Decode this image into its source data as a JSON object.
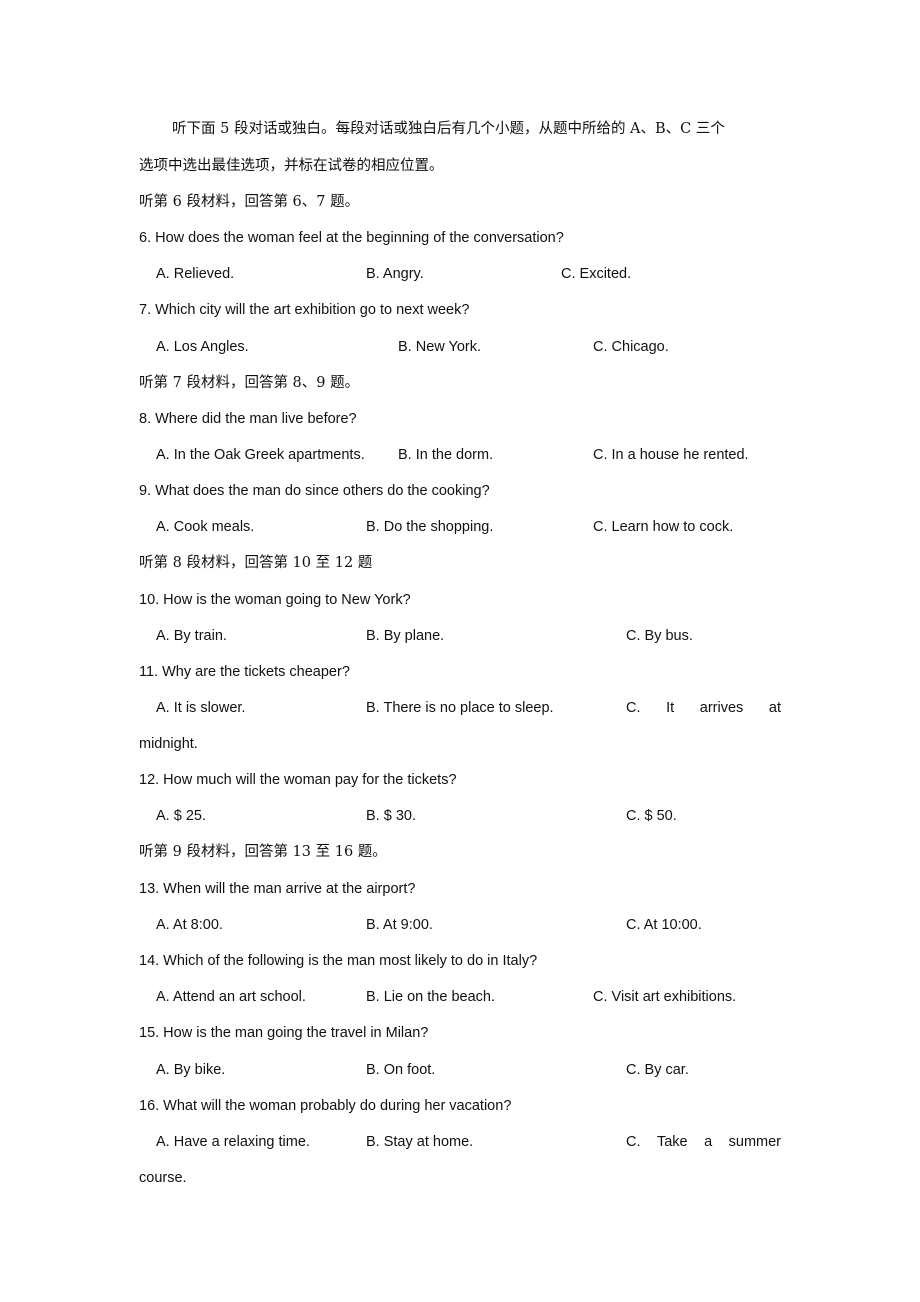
{
  "intro": {
    "line1": "听下面 5 段对话或独白。每段对话或独白后有几个小题，从题中所给的 A、B、C 三个",
    "line2": "选项中选出最佳选项，并标在试卷的相应位置。"
  },
  "sections": [
    {
      "heading": "听第 6 段材料，回答第 6、7 题。",
      "questions": [
        {
          "stem": "6. How does the woman feel at the beginning of the conversation?",
          "options": [
            "A. Relieved.",
            "B. Angry.",
            "C. Excited."
          ]
        },
        {
          "stem": "7. Which city will the art exhibition go to next week?",
          "options": [
            "A. Los Angles.",
            "B. New York.",
            "C. Chicago."
          ]
        }
      ]
    },
    {
      "heading": "听第 7 段材料，回答第 8、9 题。",
      "questions": [
        {
          "stem": "8. Where did the man live before?",
          "options": [
            "A. In the Oak Greek apartments.",
            "B. In the dorm.",
            "C. In a house he rented."
          ]
        },
        {
          "stem": "9. What does the man do since others do the cooking?",
          "options": [
            "A. Cook meals.",
            "B. Do the shopping.",
            "C. Learn how to cock."
          ]
        }
      ]
    },
    {
      "heading": "听第 8 段材料，回答第 10 至 12 题",
      "questions": [
        {
          "stem": "10. How is the woman going to New York?",
          "options": [
            "A. By train.",
            "B. By plane.",
            "C. By bus."
          ]
        },
        {
          "stem": "11. Why are the tickets cheaper?",
          "options": [
            "A. It is slower.",
            "B. There is no place to sleep.",
            "C. It arrives at midnight."
          ],
          "option_c_words": [
            "C.",
            "It",
            "arrives",
            "at"
          ],
          "option_c_wrap": "midnight."
        },
        {
          "stem": "12. How much will the woman pay for the tickets?",
          "options": [
            "A. $ 25.",
            "B. $ 30.",
            "C. $ 50."
          ]
        }
      ]
    },
    {
      "heading": "听第 9 段材料，回答第 13 至 16 题。",
      "questions": [
        {
          "stem": "13. When will the man arrive at the airport?",
          "options": [
            "A. At 8:00.",
            "B. At 9:00.",
            "C. At 10:00."
          ]
        },
        {
          "stem": "14. Which of the following is the man most likely to do in Italy?",
          "options": [
            "A. Attend an art school.",
            "B. Lie on the beach.",
            "C. Visit art exhibitions."
          ]
        },
        {
          "stem": "15. How is the man going the travel in Milan?",
          "options": [
            "A. By bike.",
            "B. On foot.",
            "C. By car."
          ]
        },
        {
          "stem": "16. What will the woman probably do during her vacation?",
          "options": [
            "A. Have a relaxing time.",
            "B. Stay at home.",
            "C. Take a summer course."
          ],
          "option_c_words": [
            "C.",
            "Take",
            "a",
            "summer"
          ],
          "option_c_wrap": "course."
        }
      ]
    }
  ]
}
